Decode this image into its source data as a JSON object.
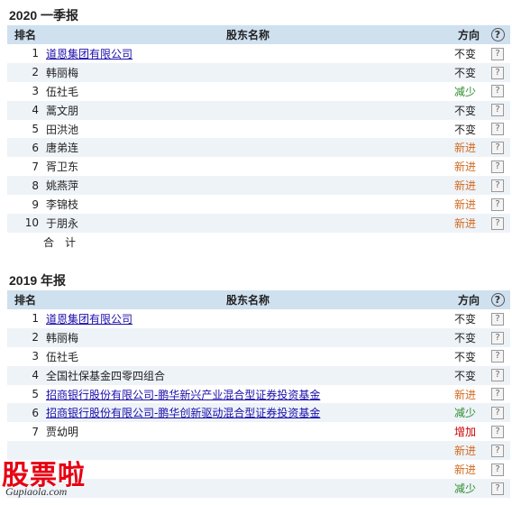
{
  "sections": [
    {
      "title": "2020 一季报",
      "headers": {
        "rank": "排名",
        "name": "股东名称",
        "direction": "方向"
      },
      "rows": [
        {
          "rank": "1",
          "name": "道恩集团有限公司",
          "link": true,
          "direction": "不变",
          "dir_type": "same"
        },
        {
          "rank": "2",
          "name": "韩丽梅",
          "link": false,
          "direction": "不变",
          "dir_type": "same"
        },
        {
          "rank": "3",
          "name": "伍社毛",
          "link": false,
          "direction": "减少",
          "dir_type": "dec"
        },
        {
          "rank": "4",
          "name": "蒿文朋",
          "link": false,
          "direction": "不变",
          "dir_type": "same"
        },
        {
          "rank": "5",
          "name": "田洪池",
          "link": false,
          "direction": "不变",
          "dir_type": "same"
        },
        {
          "rank": "6",
          "name": "唐弟连",
          "link": false,
          "direction": "新进",
          "dir_type": "new"
        },
        {
          "rank": "7",
          "name": "胥卫东",
          "link": false,
          "direction": "新进",
          "dir_type": "new"
        },
        {
          "rank": "8",
          "name": "姚燕萍",
          "link": false,
          "direction": "新进",
          "dir_type": "new"
        },
        {
          "rank": "9",
          "name": "李锦枝",
          "link": false,
          "direction": "新进",
          "dir_type": "new"
        },
        {
          "rank": "10",
          "name": "于朋永",
          "link": false,
          "direction": "新进",
          "dir_type": "new"
        }
      ],
      "total_label": "合　计"
    },
    {
      "title": "2019 年报",
      "headers": {
        "rank": "排名",
        "name": "股东名称",
        "direction": "方向"
      },
      "rows": [
        {
          "rank": "1",
          "name": "道恩集团有限公司",
          "link": true,
          "direction": "不变",
          "dir_type": "same"
        },
        {
          "rank": "2",
          "name": "韩丽梅",
          "link": false,
          "direction": "不变",
          "dir_type": "same"
        },
        {
          "rank": "3",
          "name": "伍社毛",
          "link": false,
          "direction": "不变",
          "dir_type": "same"
        },
        {
          "rank": "4",
          "name": "全国社保基金四零四组合",
          "link": false,
          "direction": "不变",
          "dir_type": "same"
        },
        {
          "rank": "5",
          "name": "招商银行股份有限公司-鹏华新兴产业混合型证券投资基金",
          "link": true,
          "direction": "新进",
          "dir_type": "new"
        },
        {
          "rank": "6",
          "name": "招商银行股份有限公司-鹏华创新驱动混合型证券投资基金",
          "link": true,
          "direction": "减少",
          "dir_type": "dec"
        },
        {
          "rank": "7",
          "name": "贾幼明",
          "link": false,
          "direction": "增加",
          "dir_type": "inc"
        },
        {
          "rank": "",
          "name": "",
          "link": false,
          "direction": "新进",
          "dir_type": "new"
        },
        {
          "rank": "",
          "name": "",
          "link": false,
          "direction": "新进",
          "dir_type": "new"
        },
        {
          "rank": "",
          "name": "",
          "link": false,
          "direction": "减少",
          "dir_type": "dec"
        }
      ]
    }
  ],
  "help_box_glyph": "?",
  "help_circle_glyph": "?",
  "watermark": {
    "cn": "股票啦",
    "en": "Gupiaola.com"
  },
  "colors": {
    "header_bg": "#cfe0ef",
    "stripe_bg": "#eef3f8",
    "link": "#1a0dab",
    "new": "#d2691e",
    "decrease": "#2e8b2e",
    "increase": "#cc0000",
    "watermark": "#e60012"
  }
}
